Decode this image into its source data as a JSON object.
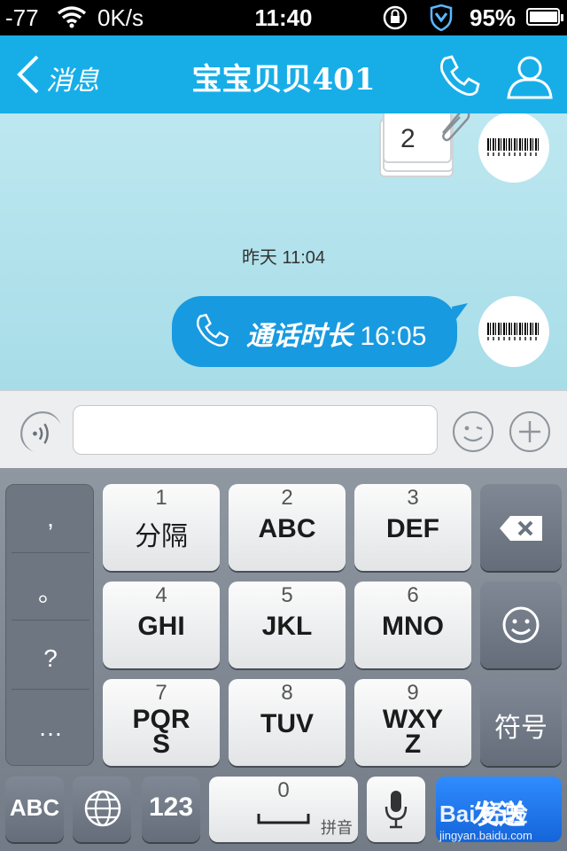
{
  "status_bar": {
    "signal": "-77",
    "speed": "0K/s",
    "time": "11:40",
    "battery": "95%",
    "battery_level": 0.95
  },
  "header": {
    "back_label": "消息",
    "title": "宝宝贝贝401"
  },
  "chat": {
    "note_number": "2",
    "timestamp": "昨天 11:04",
    "call_label": "通话时长",
    "call_duration": "16:05"
  },
  "keyboard": {
    "punctuation": [
      ",",
      "。",
      "?",
      "…"
    ],
    "keys": [
      {
        "num": "1",
        "label": "分隔"
      },
      {
        "num": "2",
        "label": "ABC"
      },
      {
        "num": "3",
        "label": "DEF"
      },
      {
        "num": "4",
        "label": "GHI"
      },
      {
        "num": "5",
        "label": "JKL"
      },
      {
        "num": "6",
        "label": "MNO"
      },
      {
        "num": "7",
        "label": "PQR",
        "label2": "S"
      },
      {
        "num": "8",
        "label": "TUV"
      },
      {
        "num": "9",
        "label": "WXY",
        "label2": "Z"
      }
    ],
    "symbols_label": "符号",
    "abc_label": "ABC",
    "num_label": "123",
    "space_num": "0",
    "pinyin_label": "拼音",
    "send_label": "发送"
  },
  "watermark": {
    "brand": "Bai 经验",
    "url": "jingyan.baidu.com"
  },
  "colors": {
    "header": "#17aee8",
    "bubble": "#189ae0",
    "send": "#1f78ee"
  }
}
